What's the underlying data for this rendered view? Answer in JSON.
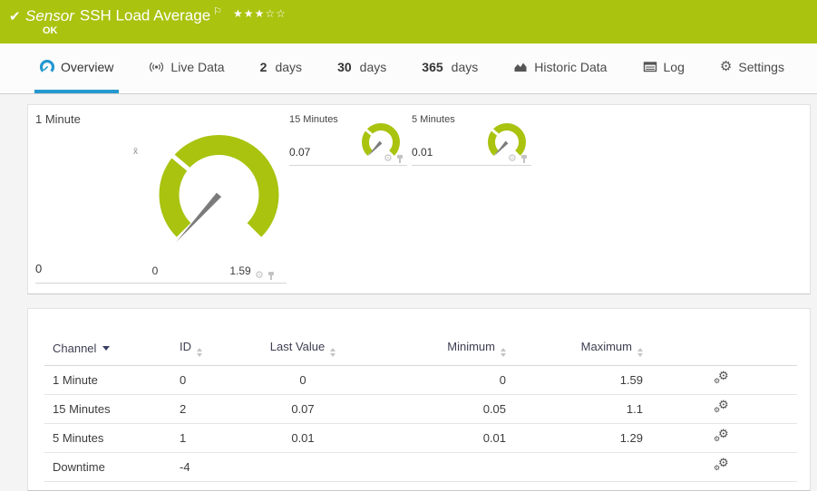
{
  "colors": {
    "accent_green": "#a9c30f",
    "accent_blue": "#2598d0",
    "needle_gray": "#7b7b7b"
  },
  "header": {
    "check_icon": "check-ok",
    "kind": "Sensor",
    "title": "SSH Load Average",
    "flag_icon": "flag",
    "stars": "★★★☆☆",
    "status": "OK"
  },
  "tabs": [
    {
      "strong": "",
      "label": "Overview",
      "active": true
    },
    {
      "strong": "",
      "label": "Live Data",
      "active": false
    },
    {
      "strong": "2",
      "label": "days",
      "active": false
    },
    {
      "strong": "30",
      "label": "days",
      "active": false
    },
    {
      "strong": "365",
      "label": "days",
      "active": false
    },
    {
      "strong": "",
      "label": "Historic Data",
      "active": false
    },
    {
      "strong": "",
      "label": "Log",
      "active": false
    },
    {
      "strong": "",
      "label": "Settings",
      "active": false
    }
  ],
  "gauges": {
    "primary": {
      "label": "1 Minute",
      "value": "0",
      "scale_start": "0",
      "scale_end": "1.59",
      "avg_marker": "x̄"
    },
    "small": [
      {
        "label": "15 Minutes",
        "value": "0.07"
      },
      {
        "label": "5 Minutes",
        "value": "0.01"
      }
    ]
  },
  "chart_data": [
    {
      "type": "gauge",
      "title": "1 Minute",
      "value": 0,
      "min": 0,
      "max": 1.59
    },
    {
      "type": "gauge",
      "title": "15 Minutes",
      "value": 0.07,
      "min": 0.05,
      "max": 1.1
    },
    {
      "type": "gauge",
      "title": "5 Minutes",
      "value": 0.01,
      "min": 0.01,
      "max": 1.29
    }
  ],
  "channel_table": {
    "columns": {
      "channel": "Channel",
      "id": "ID",
      "last_value": "Last Value",
      "minimum": "Minimum",
      "maximum": "Maximum"
    },
    "rows": [
      {
        "channel": "1 Minute",
        "id": "0",
        "last_value": "0",
        "minimum": "0",
        "maximum": "1.59"
      },
      {
        "channel": "15 Minutes",
        "id": "2",
        "last_value": "0.07",
        "minimum": "0.05",
        "maximum": "1.1"
      },
      {
        "channel": "5 Minutes",
        "id": "1",
        "last_value": "0.01",
        "minimum": "0.01",
        "maximum": "1.29"
      },
      {
        "channel": "Downtime",
        "id": "-4",
        "last_value": "",
        "minimum": "",
        "maximum": ""
      }
    ]
  }
}
